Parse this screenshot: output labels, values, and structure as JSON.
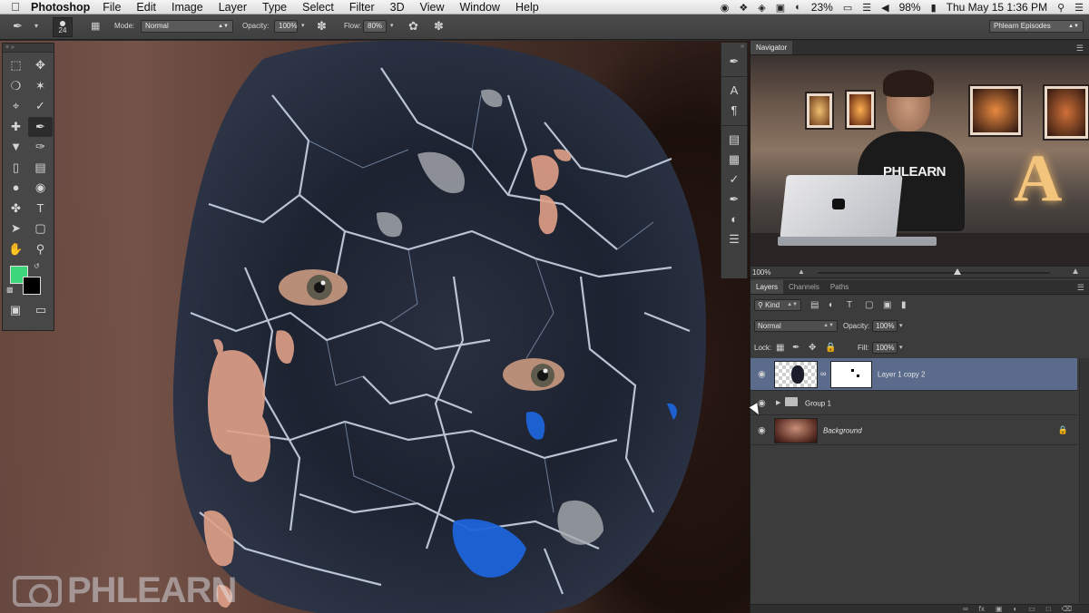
{
  "menubar": {
    "app_name": "Photoshop",
    "menus": [
      "File",
      "Edit",
      "Image",
      "Layer",
      "Type",
      "Select",
      "Filter",
      "3D",
      "View",
      "Window",
      "Help"
    ],
    "battery_percent": "23%",
    "battery2_percent": "98%",
    "clock": "Thu May 15  1:36 PM"
  },
  "options_bar": {
    "brush_size": "24",
    "mode_label": "Mode:",
    "mode_value": "Normal",
    "opacity_label": "Opacity:",
    "opacity_value": "100%",
    "flow_label": "Flow:",
    "flow_value": "80%",
    "workspace": "Phlearn Episodes"
  },
  "colors": {
    "foreground": "#3ed67a",
    "background": "#000000",
    "selection": "#5a6b8c"
  },
  "navigator": {
    "title": "Navigator",
    "zoom": "100%",
    "zoom_slider_fraction": 0.6,
    "shirt_text": "PHLEARN",
    "sign_letter": "A"
  },
  "layers_panel": {
    "tabs": [
      "Layers",
      "Channels",
      "Paths"
    ],
    "filter_kind": "Kind",
    "blend_mode": "Normal",
    "opacity_label": "Opacity:",
    "opacity_value": "100%",
    "lock_label": "Lock:",
    "fill_label": "Fill:",
    "fill_value": "100%",
    "layers": [
      {
        "name": "Layer 1 copy 2",
        "selected": true
      },
      {
        "name": "Group 1",
        "selected": false
      },
      {
        "name": "Background",
        "selected": false
      }
    ]
  },
  "watermark": "PHLEARN"
}
